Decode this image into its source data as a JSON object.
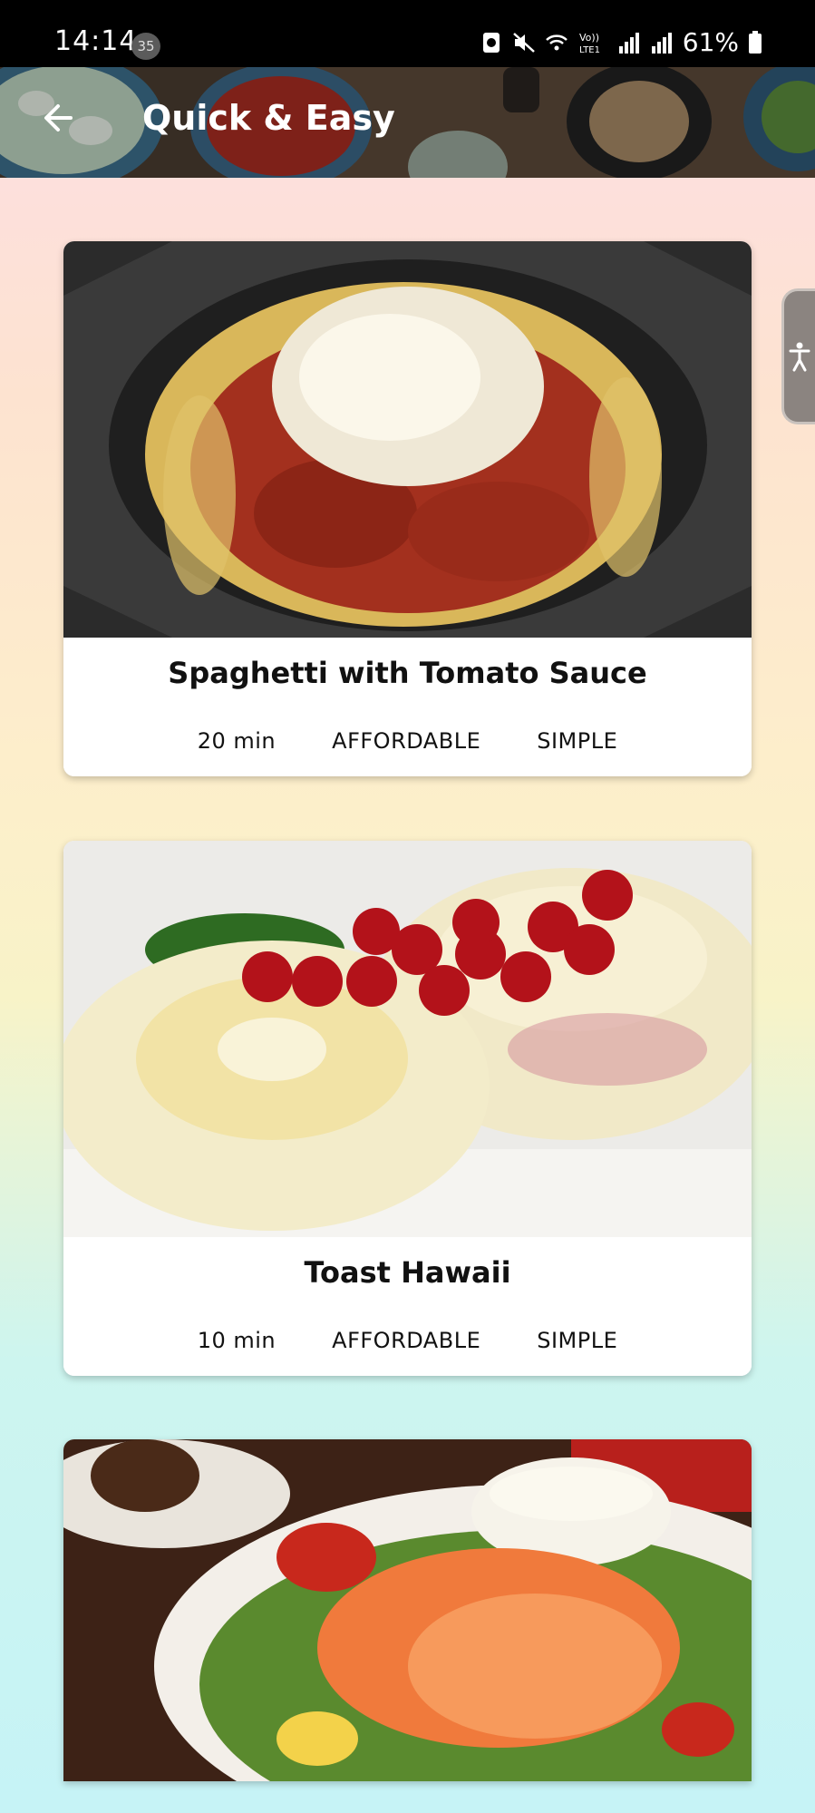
{
  "status_bar": {
    "time": "14:14",
    "notification_count": "35",
    "battery": "61%",
    "network_label": "Vo)) LTE1"
  },
  "app_bar": {
    "title": "Quick & Easy"
  },
  "meals": [
    {
      "title": "Spaghetti with Tomato Sauce",
      "duration": "20 min",
      "affordability": "AFFORDABLE",
      "complexity": "SIMPLE"
    },
    {
      "title": "Toast Hawaii",
      "duration": "10 min",
      "affordability": "AFFORDABLE",
      "complexity": "SIMPLE"
    },
    {
      "title": "",
      "duration": "",
      "affordability": "",
      "complexity": ""
    }
  ],
  "colors": {
    "status_bar": "#000000",
    "card": "#ffffff",
    "background_top": "#fddde6",
    "background_bottom": "#c6f3f6"
  }
}
